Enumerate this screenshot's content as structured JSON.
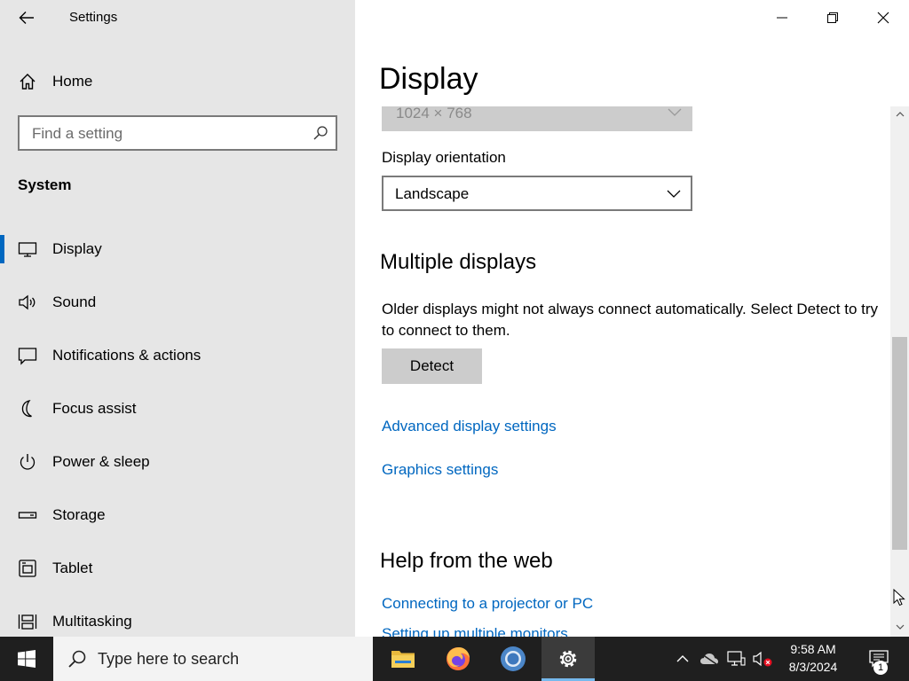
{
  "window": {
    "app_title": "Settings",
    "minimize_icon": "minimize-icon",
    "maximize_icon": "maximize-icon",
    "close_icon": "close-icon"
  },
  "sidebar": {
    "home_label": "Home",
    "search_placeholder": "Find a setting",
    "section_title": "System",
    "items": [
      {
        "label": "Display",
        "icon": "monitor-icon",
        "active": true
      },
      {
        "label": "Sound",
        "icon": "speaker-icon",
        "active": false
      },
      {
        "label": "Notifications & actions",
        "icon": "message-icon",
        "active": false
      },
      {
        "label": "Focus assist",
        "icon": "moon-icon",
        "active": false
      },
      {
        "label": "Power & sleep",
        "icon": "power-icon",
        "active": false
      },
      {
        "label": "Storage",
        "icon": "drive-icon",
        "active": false
      },
      {
        "label": "Tablet",
        "icon": "tablet-icon",
        "active": false
      },
      {
        "label": "Multitasking",
        "icon": "multitasking-icon",
        "active": false
      }
    ]
  },
  "main": {
    "page_title": "Display",
    "resolution_value": "1024 × 768",
    "orientation_label": "Display orientation",
    "orientation_value": "Landscape",
    "multiple_displays_heading": "Multiple displays",
    "multiple_displays_desc": "Older displays might not always connect automatically. Select Detect to try to connect to them.",
    "detect_label": "Detect",
    "links": [
      "Advanced display settings",
      "Graphics settings"
    ],
    "help_heading": "Help from the web",
    "help_links": [
      "Connecting to a projector or PC",
      "Setting up multiple monitors"
    ]
  },
  "taskbar": {
    "search_placeholder": "Type here to search",
    "apps": [
      "file-explorer-icon",
      "firefox-icon",
      "chrome-icon",
      "settings-icon"
    ],
    "time": "9:58 AM",
    "date": "8/3/2024",
    "notification_count": "1",
    "accent_color": "#0067c0"
  }
}
